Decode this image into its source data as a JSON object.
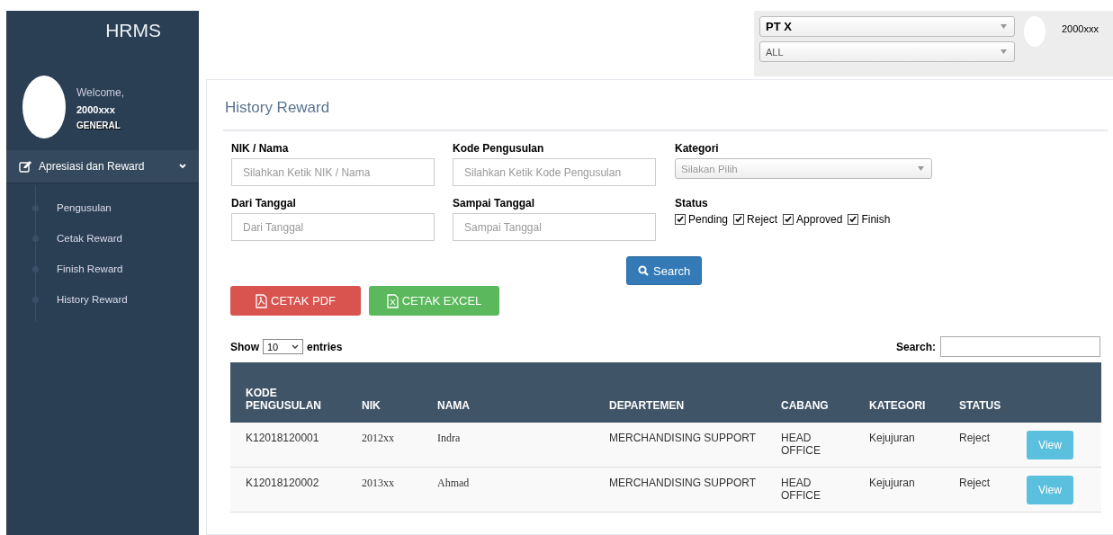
{
  "sidebar": {
    "brand": "HRMS",
    "welcome": "Welcome,",
    "user_id": "2000xxx",
    "role": "GENERAL",
    "menu": {
      "label": "Apresiasi dan Reward",
      "expanded": true,
      "children": [
        {
          "label": "Pengusulan"
        },
        {
          "label": "Cetak Reward"
        },
        {
          "label": "Finish Reward"
        },
        {
          "label": "History Reward"
        }
      ]
    }
  },
  "topbar": {
    "company": "PT X",
    "branch": "ALL",
    "user_id": "2000xxx"
  },
  "page_title": "History Reward",
  "filters": {
    "fields": [
      {
        "label": "NIK / Nama",
        "kind": "text",
        "placeholder": "Silahkan Ketik NIK / Nama"
      },
      {
        "label": "Kode Pengusulan",
        "kind": "text",
        "placeholder": "Silahkan Ketik Kode Pengusulan"
      },
      {
        "label": "Kategori",
        "kind": "select",
        "placeholder": "Silakan Pilih"
      },
      {
        "label": "Dari Tanggal",
        "kind": "text",
        "placeholder": "Dari Tanggal"
      },
      {
        "label": "Sampai Tanggal",
        "kind": "text",
        "placeholder": "Sampai Tanggal"
      },
      {
        "label": "Status",
        "kind": "checks",
        "options": [
          {
            "label": "Pending",
            "checked": true
          },
          {
            "label": "Reject",
            "checked": true
          },
          {
            "label": "Approved",
            "checked": true
          },
          {
            "label": "Finish",
            "checked": true
          }
        ]
      }
    ],
    "search_button": "Search"
  },
  "export_buttons": [
    {
      "label": "CETAK PDF",
      "kind": "pdf"
    },
    {
      "label": "CETAK EXCEL",
      "kind": "excel"
    }
  ],
  "table": {
    "show_label": "Show",
    "page_size": "10",
    "entries_label": "entries",
    "search_label": "Search:",
    "columns": [
      "KODE PENGUSULAN",
      "NIK",
      "NAMA",
      "DEPARTEMEN",
      "CABANG",
      "KATEGORI",
      "STATUS"
    ],
    "rows": [
      {
        "cells": [
          "K12018120001",
          "2012xx",
          "Indra",
          "MERCHANDISING SUPPORT",
          "HEAD OFFICE",
          "Kejujuran",
          "Reject"
        ],
        "action": "View"
      },
      {
        "cells": [
          "K12018120002",
          "2013xx",
          "Ahmad",
          "MERCHANDISING SUPPORT",
          "HEAD OFFICE",
          "Kejujuran",
          "Reject"
        ],
        "action": "View"
      }
    ]
  }
}
